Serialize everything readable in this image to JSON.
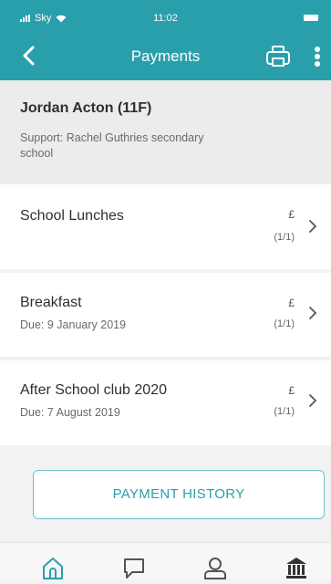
{
  "status_bar": {
    "carrier": "Sky",
    "time": "11:02"
  },
  "nav": {
    "title": "Payments"
  },
  "student": {
    "name": "Jordan Acton (11F)",
    "support": "Support: Rachel Guthries secondary school"
  },
  "payments": [
    {
      "title": "School Lunches",
      "due": "",
      "currency": "£",
      "count": "(1/1)"
    },
    {
      "title": "Breakfast",
      "due": "Due: 9 January 2019",
      "currency": "£",
      "count": "(1/1)"
    },
    {
      "title": "After School club 2020",
      "due": "Due: 7 August 2019",
      "currency": "£",
      "count": "(1/1)"
    }
  ],
  "actions": {
    "payment_history": "PAYMENT HISTORY"
  },
  "tabs": [
    {
      "icon": "home-icon"
    },
    {
      "icon": "message-icon"
    },
    {
      "icon": "user-icon"
    },
    {
      "icon": "bank-icon"
    }
  ],
  "colors": {
    "accent": "#2a9fac",
    "background": "#f2f2f2"
  }
}
